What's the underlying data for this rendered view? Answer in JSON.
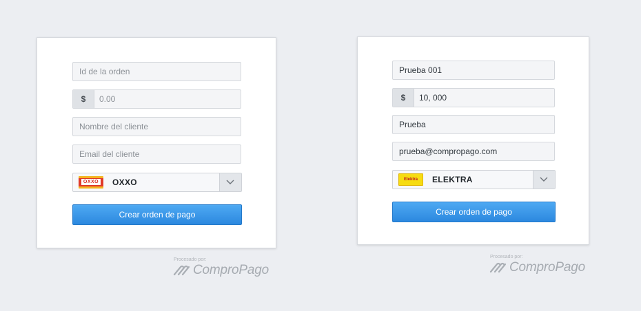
{
  "colors": {
    "page_bg": "#eceef2",
    "button_blue": "#3a96e8",
    "oxxo_red": "#e0392a",
    "oxxo_yellow": "#f4b421",
    "elektra_yellow": "#f6dc12"
  },
  "left_form": {
    "order_id_placeholder": "Id de la orden",
    "currency_symbol": "$",
    "amount_placeholder": "0.00",
    "name_placeholder": "Nombre del cliente",
    "email_placeholder": "Email del cliente",
    "provider_logo_text": "OXXO",
    "provider_label": "OXXO",
    "submit_label": "Crear orden de pago",
    "processed_by": "Procesado por:",
    "brand_name": "ComproPago"
  },
  "right_form": {
    "order_id_value": "Prueba 001",
    "currency_symbol": "$",
    "amount_value": "10, 000",
    "name_value": "Prueba",
    "email_value": "prueba@compropago.com",
    "provider_logo_text": "Elektra",
    "provider_label": "ELEKTRA",
    "submit_label": "Crear orden de pago",
    "processed_by": "Procesado por:",
    "brand_name": "ComproPago"
  },
  "icons": {
    "dropdown": "chevron-down-icon",
    "brand_logo": "compropago-logo-icon"
  }
}
